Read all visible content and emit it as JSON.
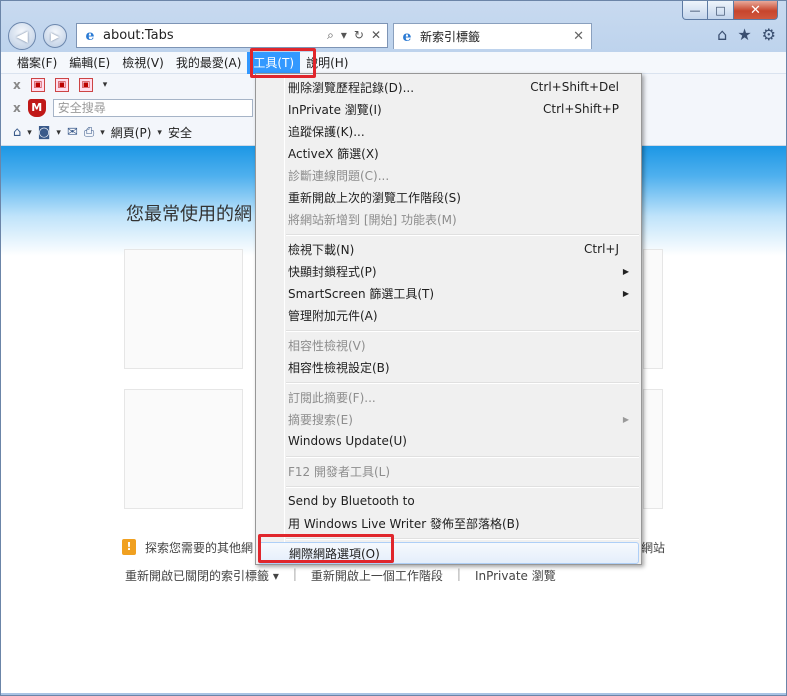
{
  "window": {
    "minimize": "—",
    "maximize": "□",
    "close": "✕"
  },
  "nav": {
    "back_icon": "◀",
    "forward_icon": "▶"
  },
  "address": {
    "ie_icon": "e",
    "url": "about:Tabs",
    "search_icon": "⌕",
    "dropdown_icon": "▾",
    "refresh_icon": "↻",
    "stop_icon": "✕"
  },
  "tab": {
    "ie_icon": "e",
    "title": "新索引標籤",
    "close": "✕"
  },
  "right_icons": {
    "home": "⌂",
    "favorites": "★",
    "settings": "⚙"
  },
  "menubar": {
    "items": [
      "檔案(F)",
      "編輯(E)",
      "檢視(V)",
      "我的最愛(A)",
      "工具(T)",
      "說明(H)"
    ]
  },
  "toolbar1": {
    "x": "x",
    "icon1": "▣",
    "icon2": "▣",
    "icon3": "▣",
    "dd": "▾"
  },
  "toolbar2": {
    "x": "x",
    "mcafee": "M",
    "search_placeholder": "安全搜尋"
  },
  "toolbar3": {
    "home_icon": "⌂",
    "rss_icon": "◙",
    "mail_icon": "✉",
    "print_icon": "⎙",
    "page": "網頁(P)",
    "safety": "安全"
  },
  "content": {
    "most_used": "您最常使用的網",
    "discover_icon": "!",
    "discover_text": "探索您需要的其他網",
    "site_tail": "網站",
    "links": [
      "重新開啟已關閉的索引標籤 ▾",
      "重新開啟上一個工作階段",
      "InPrivate 瀏覽"
    ],
    "link_sep": "|"
  },
  "menu": {
    "g1": [
      {
        "label": "刪除瀏覽歷程記錄(D)...",
        "shortcut": "Ctrl+Shift+Del",
        "disabled": false
      },
      {
        "label": "InPrivate 瀏覽(I)",
        "shortcut": "Ctrl+Shift+P",
        "disabled": false
      },
      {
        "label": "追蹤保護(K)...",
        "shortcut": "",
        "disabled": false
      },
      {
        "label": "ActiveX 篩選(X)",
        "shortcut": "",
        "disabled": false
      },
      {
        "label": "診斷連線問題(C)...",
        "shortcut": "",
        "disabled": true
      },
      {
        "label": "重新開啟上次的瀏覽工作階段(S)",
        "shortcut": "",
        "disabled": false
      },
      {
        "label": "將網站新增到 [開始] 功能表(M)",
        "shortcut": "",
        "disabled": true
      }
    ],
    "g2": [
      {
        "label": "檢視下載(N)",
        "shortcut": "Ctrl+J",
        "arrow": false
      },
      {
        "label": "快顯封鎖程式(P)",
        "shortcut": "",
        "arrow": true
      },
      {
        "label": "SmartScreen 篩選工具(T)",
        "shortcut": "",
        "arrow": true
      },
      {
        "label": "管理附加元件(A)",
        "shortcut": "",
        "arrow": false
      }
    ],
    "g3": [
      {
        "label": "相容性檢視(V)",
        "disabled": true
      },
      {
        "label": "相容性檢視設定(B)",
        "disabled": false
      }
    ],
    "g4": [
      {
        "label": "訂閱此摘要(F)...",
        "disabled": true,
        "arrow": false
      },
      {
        "label": "摘要搜索(E)",
        "disabled": true,
        "arrow": true
      },
      {
        "label": "Windows Update(U)",
        "disabled": false,
        "arrow": false
      }
    ],
    "g5": [
      {
        "label": "F12 開發者工具(L)",
        "disabled": true
      }
    ],
    "g6": [
      {
        "label": "Send by Bluetooth to",
        "disabled": false
      },
      {
        "label": "用 Windows Live Writer 發佈至部落格(B)",
        "disabled": false
      }
    ],
    "g7": [
      {
        "label": "網際網路選項(O)",
        "disabled": false
      }
    ],
    "arrow_glyph": "▶"
  },
  "highlight_color": "#e0262c"
}
